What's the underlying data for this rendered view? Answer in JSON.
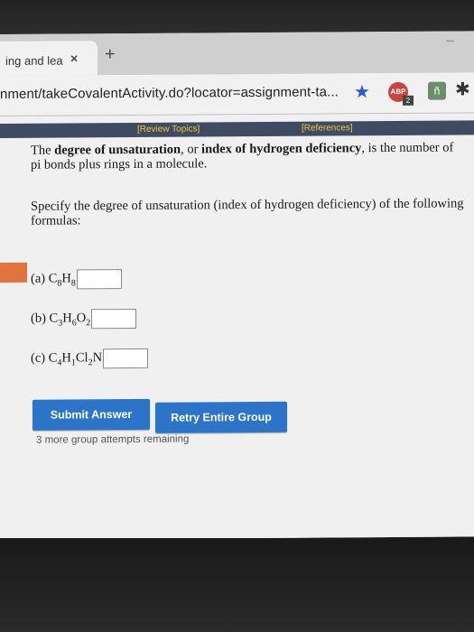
{
  "browser": {
    "tab_title": "ing and lea",
    "tab_close": "×",
    "new_tab": "+",
    "window_min": "–",
    "url": "nment/takeCovalentActivity.do?locator=assignment-ta...",
    "bookmark_star": "★",
    "ext_abp_label": "ABP",
    "ext_abp_badge": "2",
    "ext_second": "ñ",
    "ext_third": "✱",
    "accent_color": "#2a5ad8"
  },
  "page": {
    "links": {
      "review_topics": "[Review Topics]",
      "references": "[References]"
    },
    "intro": {
      "part1": "The ",
      "term1": "degree of unsaturation",
      "part2": ", or ",
      "term2": "index of hydrogen deficiency",
      "part3": ", is the number of pi bonds plus rings in a molecule."
    },
    "instruction": "Specify the degree of unsaturation (index of hydrogen deficiency) of the following formulas:",
    "questions": [
      {
        "prefix": "(a) ",
        "formula": [
          {
            "t": "C"
          },
          {
            "s": "8"
          },
          {
            "t": "H"
          },
          {
            "s": "8"
          }
        ],
        "value": ""
      },
      {
        "prefix": "(b) ",
        "formula": [
          {
            "t": "C"
          },
          {
            "s": "3"
          },
          {
            "t": "H"
          },
          {
            "s": "6"
          },
          {
            "t": "O"
          },
          {
            "s": "2"
          }
        ],
        "value": ""
      },
      {
        "prefix": "(c) ",
        "formula": [
          {
            "t": "C"
          },
          {
            "s": "4"
          },
          {
            "t": "H"
          },
          {
            "s": "1"
          },
          {
            "t": "Cl"
          },
          {
            "s": "2"
          },
          {
            "t": "N"
          }
        ],
        "value": ""
      }
    ],
    "submit_label": "Submit Answer",
    "retry_label": "Retry Entire Group",
    "attempts_text": "3 more group attempts remaining",
    "button_color": "#2b74c7",
    "link_color": "#f2c93b"
  }
}
